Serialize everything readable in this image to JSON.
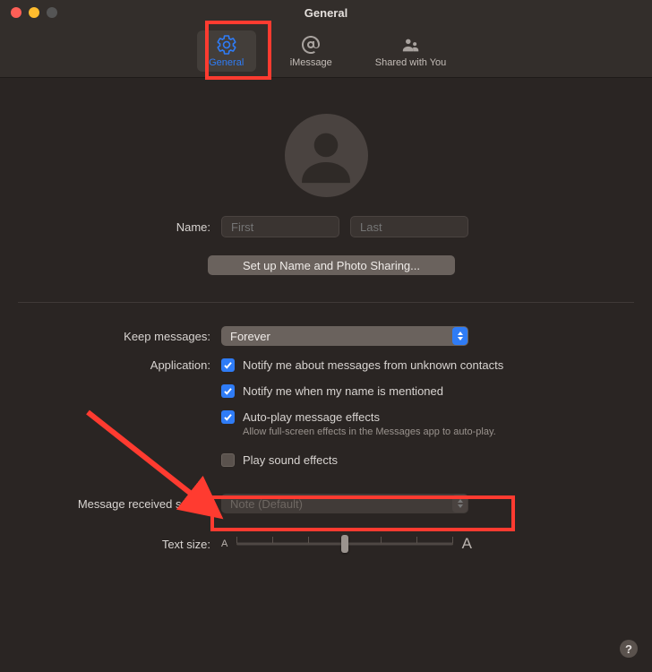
{
  "window": {
    "title": "General"
  },
  "tabs": {
    "general": "General",
    "imessage": "iMessage",
    "sharedwy": "Shared with You"
  },
  "profile": {
    "name_label": "Name:",
    "first_placeholder": "First",
    "last_placeholder": "Last",
    "setup_button": "Set up Name and Photo Sharing..."
  },
  "settings": {
    "keep_label": "Keep messages:",
    "keep_value": "Forever",
    "application_label": "Application:",
    "notify_unknown": "Notify me about messages from unknown contacts",
    "notify_mentioned": "Notify me when my name is mentioned",
    "autoplay": "Auto-play message effects",
    "autoplay_sub": "Allow full-screen effects in the Messages app to auto-play.",
    "play_sound": "Play sound effects",
    "rcv_sound_label": "Message received sound:",
    "rcv_sound_value": "Note (Default)",
    "text_size_label": "Text size:",
    "small_a": "A",
    "large_a": "A"
  },
  "help": "?"
}
